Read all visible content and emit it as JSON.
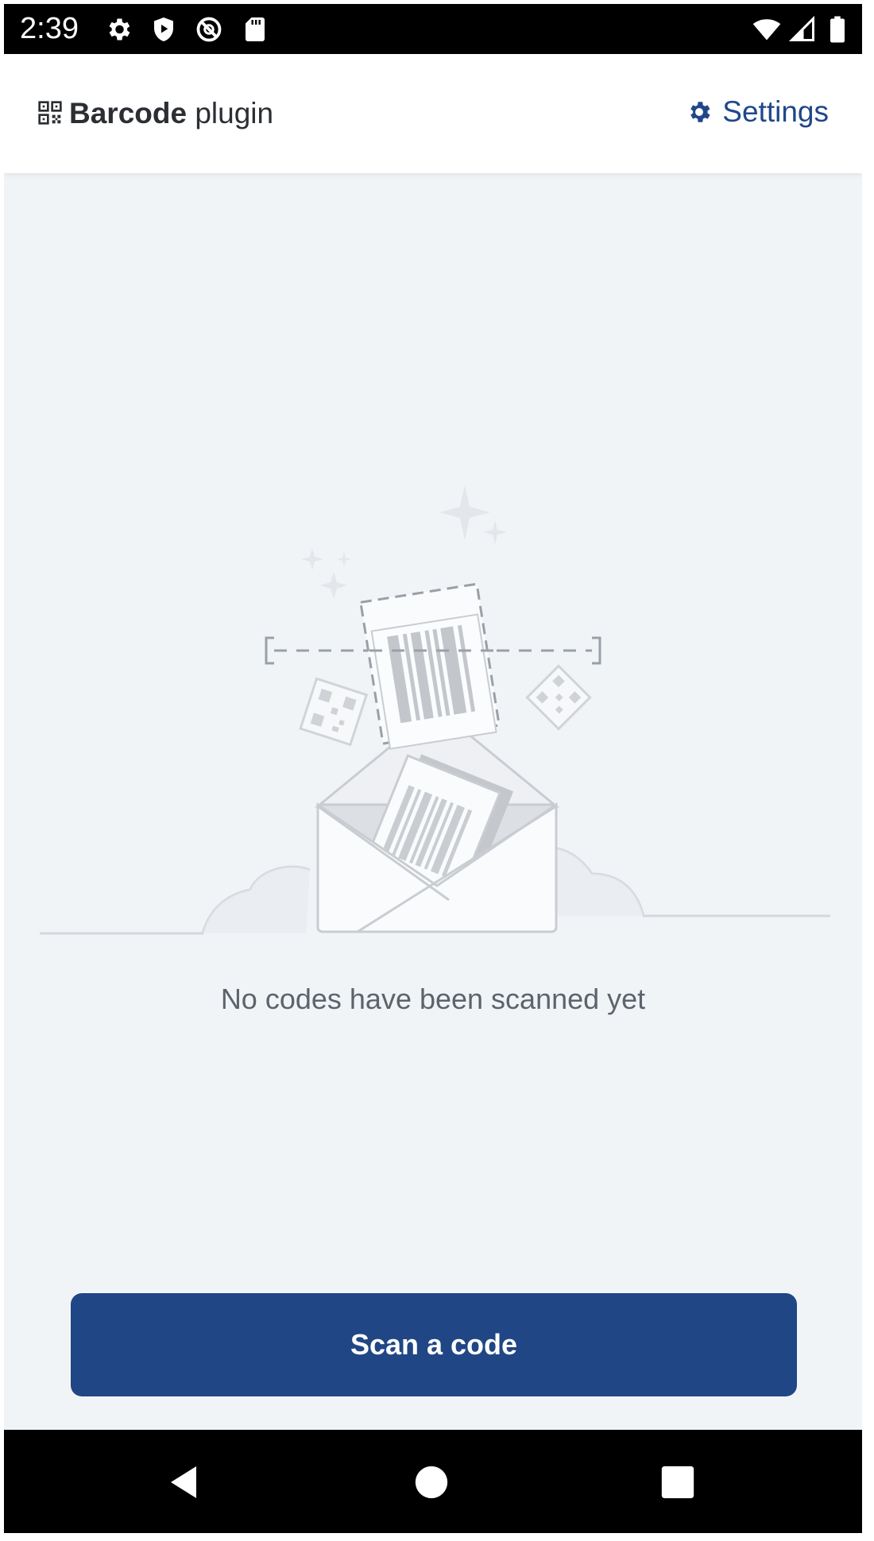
{
  "status_bar": {
    "time": "2:39",
    "left_icons": [
      "gear-icon",
      "shield-play-icon",
      "no-sync-icon",
      "sd-card-icon"
    ],
    "right_icons": [
      "wifi-icon",
      "signal-icon",
      "battery-icon"
    ]
  },
  "header": {
    "title_bold": "Barcode",
    "title_rest": " plugin",
    "settings_label": "Settings",
    "accent_color": "#20478a"
  },
  "empty_state": {
    "message": "No codes have been scanned yet"
  },
  "actions": {
    "scan_label": "Scan a code",
    "button_color": "#204685"
  },
  "nav_bar": {
    "buttons": [
      "back-icon",
      "home-icon",
      "recents-icon"
    ]
  }
}
